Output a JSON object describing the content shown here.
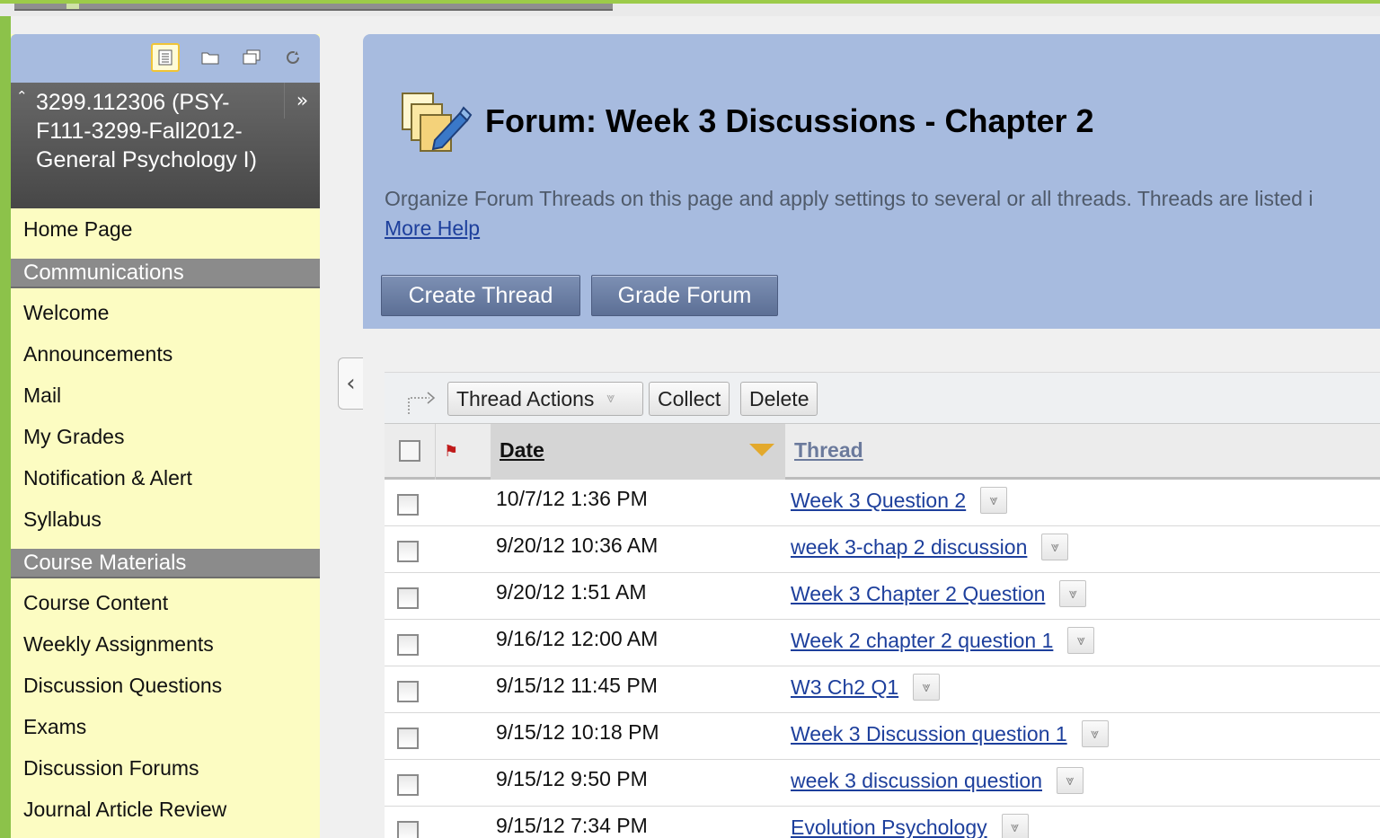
{
  "sidebar": {
    "toolbar": {
      "icons": [
        "list-view-icon",
        "folder-view-icon",
        "window-icon",
        "refresh-icon"
      ]
    },
    "course_title": "3299.112306 (PSY-F111-3299-Fall2012-General Psychology I)",
    "home": "Home Page",
    "sections": [
      {
        "heading": "Communications",
        "items": [
          "Welcome",
          "Announcements",
          "Mail",
          "My Grades",
          "Notification & Alert",
          "Syllabus"
        ]
      },
      {
        "heading": "Course Materials",
        "items": [
          "Course Content",
          "Weekly Assignments",
          "Discussion Questions",
          "Exams",
          "Discussion Forums",
          "Journal Article Review"
        ]
      }
    ]
  },
  "header": {
    "title": "Forum: Week 3 Discussions - Chapter 2",
    "description": "Organize Forum Threads on this page and apply settings to several or all threads. Threads are listed i",
    "more_help": "More Help",
    "buttons": {
      "create_thread": "Create Thread",
      "grade_forum": "Grade Forum"
    }
  },
  "actions": {
    "thread_actions": "Thread Actions",
    "collect": "Collect",
    "delete": "Delete"
  },
  "table": {
    "columns": {
      "date": "Date",
      "thread": "Thread"
    },
    "rows": [
      {
        "date": "10/7/12 1:36 PM",
        "thread": "Week 3 Question 2 "
      },
      {
        "date": "9/20/12 10:36 AM",
        "thread": "week 3-chap 2 discussion "
      },
      {
        "date": "9/20/12 1:51 AM",
        "thread": "Week 3 Chapter 2 Question "
      },
      {
        "date": "9/16/12 12:00 AM",
        "thread": "Week 2 chapter 2 question 1 "
      },
      {
        "date": "9/15/12 11:45 PM",
        "thread": "W3 Ch2 Q1 "
      },
      {
        "date": "9/15/12 10:18 PM",
        "thread": "Week 3 Discussion question 1 "
      },
      {
        "date": "9/15/12 9:50 PM",
        "thread": "week 3 discussion question "
      },
      {
        "date": "9/15/12 7:34 PM",
        "thread": "Evolution Psychology "
      }
    ]
  },
  "colors": {
    "header_bg": "#a7bbdf",
    "sidebar_bg": "#fcfcc2",
    "sidebar_heading_bg": "#8b8b8b",
    "link": "#1d3f9c",
    "accent_green": "#8cc24a"
  }
}
